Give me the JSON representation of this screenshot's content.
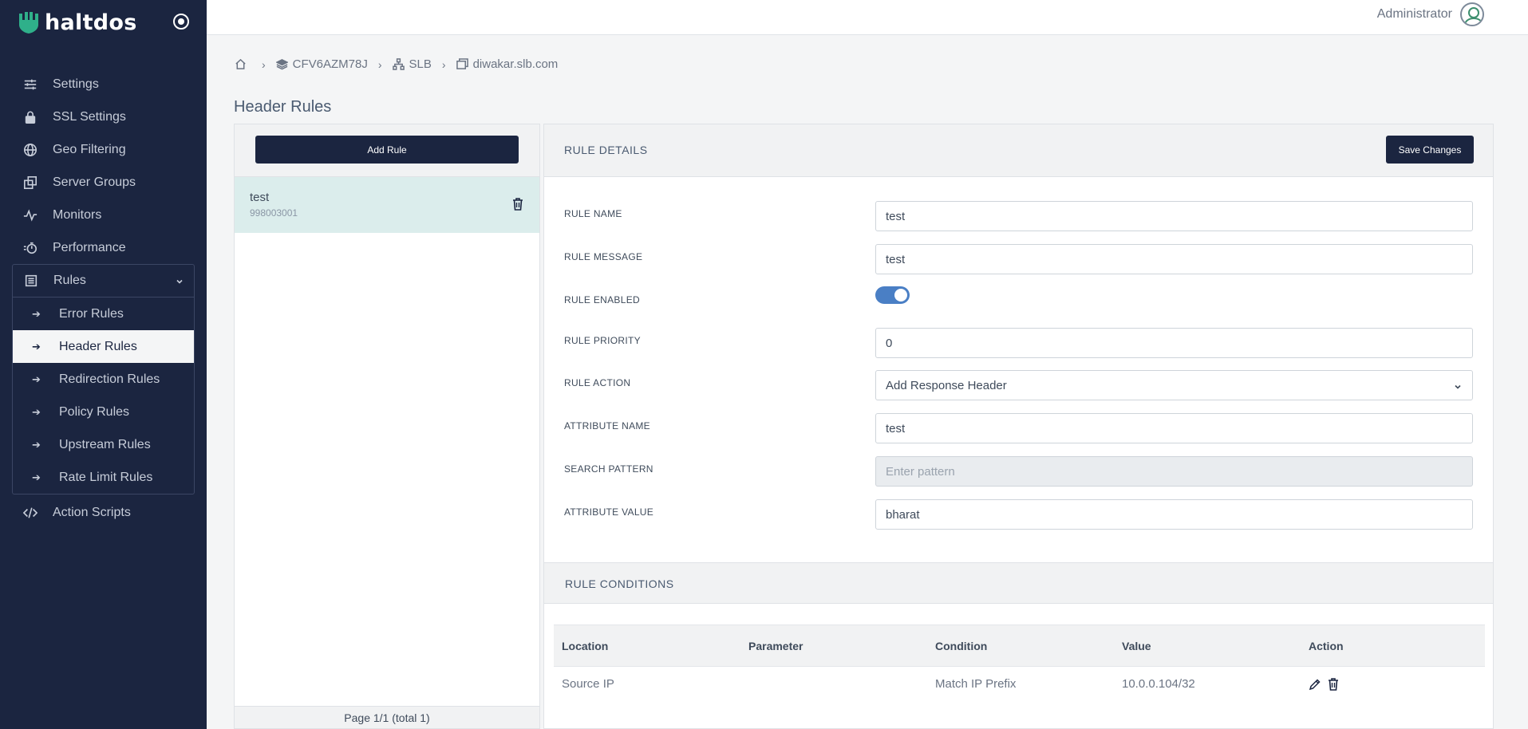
{
  "brand": {
    "name": "haltdos"
  },
  "sidebar": {
    "items": [
      {
        "label": "Settings",
        "icon": "sliders-icon"
      },
      {
        "label": "SSL Settings",
        "icon": "lock-icon"
      },
      {
        "label": "Geo Filtering",
        "icon": "globe-icon"
      },
      {
        "label": "Server Groups",
        "icon": "server-groups-icon"
      },
      {
        "label": "Monitors",
        "icon": "pulse-icon"
      },
      {
        "label": "Performance",
        "icon": "stopwatch-icon"
      }
    ],
    "rules": {
      "label": "Rules",
      "icon": "list-icon",
      "sub_items": [
        {
          "label": "Error Rules"
        },
        {
          "label": "Header Rules",
          "active": true
        },
        {
          "label": "Redirection Rules"
        },
        {
          "label": "Policy Rules"
        },
        {
          "label": "Upstream Rules"
        },
        {
          "label": "Rate Limit Rules"
        }
      ]
    },
    "after": {
      "label": "Action Scripts",
      "icon": "code-icon"
    }
  },
  "topbar": {
    "user": "Administrator"
  },
  "breadcrumb": {
    "items": [
      {
        "label": "CFV6AZM78J",
        "icon": "layers-icon"
      },
      {
        "label": "SLB",
        "icon": "sitemap-icon"
      },
      {
        "label": "diwakar.slb.com",
        "icon": "window-icon"
      }
    ]
  },
  "page_title": "Header Rules",
  "rule_list": {
    "add_label": "Add Rule",
    "items": [
      {
        "name": "test",
        "id": "998003001"
      }
    ],
    "pagination": "Page 1/1 (total 1)"
  },
  "details": {
    "title": "RULE DETAILS",
    "save_label": "Save Changes",
    "fields": {
      "rule_name": {
        "label": "RULE NAME",
        "value": "test"
      },
      "rule_message": {
        "label": "RULE MESSAGE",
        "value": "test"
      },
      "rule_enabled": {
        "label": "RULE ENABLED",
        "value": true
      },
      "rule_priority": {
        "label": "RULE PRIORITY",
        "value": "0"
      },
      "rule_action": {
        "label": "RULE ACTION",
        "value": "Add Response Header"
      },
      "attribute_name": {
        "label": "ATTRIBUTE NAME",
        "value": "test"
      },
      "search_pattern": {
        "label": "SEARCH PATTERN",
        "value": "",
        "placeholder": "Enter pattern"
      },
      "attribute_value": {
        "label": "ATTRIBUTE VALUE",
        "value": "bharat"
      }
    }
  },
  "conditions": {
    "title": "RULE CONDITIONS",
    "columns": [
      "Location",
      "Parameter",
      "Condition",
      "Value",
      "Action"
    ],
    "rows": [
      {
        "location": "Source IP",
        "parameter": "",
        "condition": "Match IP Prefix",
        "value": "10.0.0.104/32"
      }
    ]
  },
  "colors": {
    "sidebar_bg": "#1b2540",
    "accent": "#4a7fc5",
    "selected_row": "#dbedec",
    "brand_green": "#3d8f6e"
  }
}
